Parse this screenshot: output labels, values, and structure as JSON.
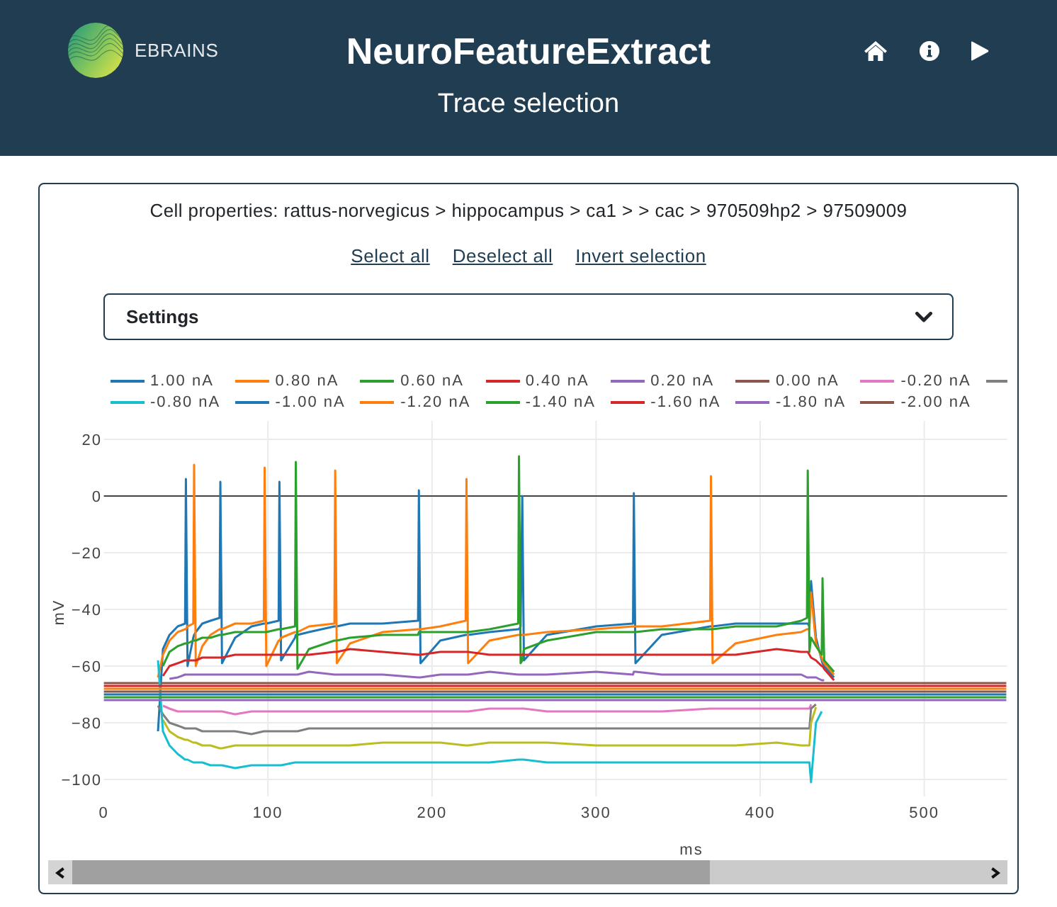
{
  "header": {
    "logo_text": "EBRAINS",
    "title": "NeuroFeatureExtract",
    "subtitle": "Trace selection"
  },
  "cell_properties": "Cell properties: rattus-norvegicus > hippocampus > ca1 > > cac > 970509hp2 > 97509009",
  "selection_links": [
    "Select all",
    "Deselect all",
    "Invert selection"
  ],
  "settings": {
    "label": "Settings",
    "expanded": false
  },
  "chart": {
    "chart_data": {
      "type": "line",
      "xlabel": "ms",
      "ylabel": "mV",
      "grid": true,
      "legend": true,
      "xlim": [
        0,
        550.5
      ],
      "ylim": [
        -106,
        26.5
      ],
      "xticks": [
        0,
        100,
        200,
        300,
        400,
        500
      ],
      "yticks": [
        20,
        0,
        {
          "value": -20,
          "label": "−20"
        },
        {
          "value": -40,
          "label": "−40"
        },
        {
          "value": -60,
          "label": "−60"
        },
        {
          "value": -80,
          "label": "−80"
        },
        {
          "value": -100,
          "label": "−100"
        }
      ],
      "x": [
        0,
        31.5,
        33,
        36,
        40,
        45,
        49.5,
        50,
        51,
        54.5,
        55,
        56,
        60,
        65,
        70.5,
        71,
        72,
        80,
        90,
        97.5,
        98,
        99,
        106.5,
        107,
        108,
        116.5,
        117,
        118,
        125,
        140.5,
        141,
        142,
        150,
        170,
        191.5,
        192,
        193,
        205,
        220.5,
        221,
        222,
        235,
        252.5,
        253,
        254,
        255,
        256,
        270,
        300,
        322.5,
        323,
        324,
        340,
        369.5,
        370,
        371,
        385,
        410,
        425,
        428.5,
        429,
        430,
        431,
        434,
        437.5,
        438,
        439,
        445,
        455,
        470,
        550
      ],
      "series": [
        {
          "name": "1.00 nA",
          "color": "#1f77b4",
          "values": [
            null,
            null,
            -83,
            -54,
            -49,
            -46,
            -45,
            6,
            -60,
            -50,
            -49,
            -48,
            -45,
            -44,
            -43,
            5,
            -59,
            -50,
            -46,
            -45,
            -45,
            -45,
            -44,
            5,
            -58,
            -50,
            -49,
            -49,
            -48,
            -46,
            -46,
            -46,
            -45,
            -45,
            -44,
            2,
            -59,
            -51,
            -49,
            -49,
            -49,
            -48,
            -47,
            -47,
            -46,
            0,
            -58,
            -49,
            -46,
            -45,
            1,
            -59,
            -49,
            -46,
            -46,
            -46,
            -45,
            -45,
            -45,
            -45,
            -45,
            -46,
            -30,
            -50,
            -58,
            -59,
            -60,
            -64,
            null,
            null,
            null
          ]
        },
        {
          "name": "0.80 nA",
          "color": "#ff7f0e",
          "values": [
            null,
            null,
            -64,
            -56,
            -51,
            -48,
            -47,
            -47,
            -46,
            -45,
            11,
            -60,
            -53,
            -49,
            -47,
            -47,
            -47,
            -45,
            -45,
            -44,
            10,
            -60,
            -51,
            -51,
            -50,
            -48,
            -48,
            -48,
            -46,
            -45,
            9,
            -59,
            -52,
            -48,
            -47,
            -47,
            -47,
            -46,
            -44,
            6,
            -59,
            -51,
            -49,
            -49,
            -49,
            -49,
            -49,
            -48,
            -47,
            -46,
            -46,
            -46,
            -46,
            -44,
            7,
            -59,
            -52,
            -49,
            -48,
            -47,
            -47,
            -47,
            -34,
            -52,
            -57,
            -58,
            -59,
            -63,
            null,
            null,
            null
          ]
        },
        {
          "name": "0.60 nA",
          "color": "#2ca02c",
          "values": [
            null,
            null,
            null,
            -60,
            -55,
            -53,
            -52,
            -52,
            -52,
            -51,
            -51,
            -51,
            -50,
            -50,
            -49,
            -49,
            -49,
            -48,
            -48,
            -48,
            -48,
            -48,
            -47,
            -47,
            -47,
            -46,
            12,
            -61,
            -54,
            -51,
            -51,
            -51,
            -50,
            -49,
            -49,
            -48,
            -48,
            -48,
            -48,
            -48,
            -48,
            -47,
            -45,
            14,
            -59,
            -58,
            -54,
            -51,
            -48,
            -48,
            -48,
            -48,
            -47,
            -47,
            -47,
            -47,
            -46,
            -46,
            -44,
            -43,
            9,
            -55,
            -50,
            -53,
            -56,
            -29,
            -58,
            -62,
            null,
            null,
            null
          ]
        },
        {
          "name": "0.40 nA",
          "color": "#d62728",
          "values": [
            null,
            null,
            null,
            -63.5,
            -60,
            -59,
            -58,
            -58,
            -58,
            -58,
            -58,
            -58,
            -57,
            -57,
            -57,
            -57,
            -57,
            -56,
            -56,
            -56,
            -56,
            -56,
            -56,
            -56,
            -56,
            -56,
            -56,
            -56,
            -56,
            -55,
            -55,
            -55,
            -54,
            -55,
            -56,
            -56,
            -56,
            -55,
            -55,
            -55,
            -55,
            -56,
            -56,
            -56,
            -56,
            -56,
            -56,
            -56,
            -56,
            -56,
            -56,
            -56,
            -56,
            -56,
            -56,
            -56,
            -56,
            -54,
            -55,
            -55,
            -55,
            -56,
            -57,
            -58,
            -60,
            -60,
            -61,
            -65,
            null,
            null,
            null
          ]
        },
        {
          "name": "0.20 nA",
          "color": "#9467bd",
          "values": [
            null,
            null,
            null,
            null,
            -64.5,
            -64,
            -63,
            -63,
            -63,
            -63,
            -63,
            -63,
            -63,
            -63,
            -63,
            -63,
            -63,
            -63,
            -63,
            -63,
            -63,
            -63,
            -63,
            -63,
            -63,
            -63,
            -63,
            -63,
            -62,
            -63,
            -63,
            -63,
            -63,
            -63,
            -64,
            -64,
            -64,
            -63,
            -63,
            -63,
            -63,
            -62,
            -63,
            -63,
            -63,
            -63,
            -63,
            -63,
            -62,
            -63,
            -62,
            -62,
            -63,
            -63,
            -63,
            -63,
            -63,
            -63,
            -63,
            -64,
            -64,
            -64,
            -64,
            -64,
            -65,
            -65,
            -65,
            null,
            null,
            null,
            null
          ]
        },
        {
          "name": "0.00 nA",
          "color": "#8c564b",
          "values": [
            -66,
            -66,
            -66,
            -66,
            -66,
            -66,
            -66,
            -66,
            -66,
            -66,
            -66,
            -66,
            -66,
            -66,
            -66,
            -66,
            -66,
            -66,
            -66,
            -66,
            -66,
            -66,
            -66,
            -66,
            -66,
            -66,
            -66,
            -66,
            -66,
            -66,
            -66,
            -66,
            -66,
            -66,
            -66,
            -66,
            -66,
            -66,
            -66,
            -66,
            -66,
            -66,
            -66,
            -66,
            -66,
            -66,
            -66,
            -66,
            -66,
            -66,
            -66,
            -66,
            -66,
            -66,
            -66,
            -66,
            -66,
            -66,
            -66,
            -66,
            -66,
            -66,
            -66,
            -66,
            -66,
            -66,
            -66,
            -66,
            -66,
            -66,
            -66
          ]
        },
        {
          "name": "-0.20 nA",
          "color": "#e377c2",
          "values": [
            null,
            null,
            null,
            -74,
            -75,
            -76,
            -76,
            -76,
            -76,
            -76,
            -76,
            -76,
            -76,
            -76,
            -76,
            -76,
            -76,
            -77,
            -76,
            -76,
            -76,
            -76,
            -76,
            -76,
            -76,
            -76,
            -76,
            -76,
            -76,
            -76,
            -76,
            -76,
            -76,
            -76,
            -76,
            -76,
            -76,
            -76,
            -76,
            -76,
            -76,
            -75,
            -75,
            -75,
            -75,
            -75,
            -75,
            -76,
            -76,
            -76,
            -76,
            -76,
            -76,
            -75,
            -75,
            -75,
            -75,
            -75,
            -75,
            -75,
            -75,
            -75,
            -73.5,
            null,
            null,
            null,
            null,
            null,
            null,
            null,
            null
          ]
        },
        {
          "color": "#7f7f7f",
          "values": [
            null,
            null,
            -74,
            -77,
            -80,
            -81,
            -82,
            -82,
            -82,
            -82,
            -82,
            -82,
            -83,
            -83,
            -83,
            -83,
            -83,
            -83,
            -84,
            -83,
            -83,
            -83,
            -83,
            -83,
            -83,
            -83,
            -83,
            -83,
            -82,
            -82,
            -82,
            -82,
            -82,
            -82,
            -82,
            -82,
            -82,
            -82,
            -82,
            -82,
            -82,
            -82,
            -82,
            -82,
            -82,
            -82,
            -82,
            -82,
            -82,
            -82,
            -82,
            -82,
            -82,
            -82,
            -82,
            -82,
            -82,
            -82,
            -82,
            -82,
            -82,
            -82,
            -75,
            -73.5,
            null,
            null,
            null,
            null,
            null,
            null,
            null
          ]
        },
        {
          "color": "#bcbd22",
          "values": [
            null,
            null,
            null,
            -79,
            -83,
            -85,
            -86,
            -86,
            -86,
            -87,
            -87,
            -87,
            -88,
            -88,
            -89,
            -89,
            -89,
            -88,
            -88,
            -88,
            -88,
            -88,
            -88,
            -88,
            -88,
            -88,
            -88,
            -88,
            -88,
            -88,
            -88,
            -88,
            -88,
            -87,
            -87,
            -87,
            -87,
            -87,
            -88,
            -88,
            -88,
            -87,
            -87,
            -87,
            -87,
            -87,
            -87,
            -87,
            -88,
            -88,
            -88,
            -88,
            -88,
            -88,
            -88,
            -88,
            -88,
            -87,
            -88,
            -88,
            -88,
            -88,
            -80,
            -74.5,
            null,
            null,
            null,
            null,
            null,
            null,
            null
          ]
        },
        {
          "name": "-0.80 nA",
          "color": "#17becf",
          "values": [
            null,
            null,
            -58,
            -83,
            -88,
            -91,
            -93,
            -93,
            -93,
            -94,
            -94,
            -94,
            -94,
            -95,
            -95,
            -95,
            -95,
            -96,
            -95,
            -95,
            -95,
            -95,
            -95,
            -95,
            -95,
            -94,
            -94,
            -94,
            -94,
            -94,
            -94,
            -94,
            -94,
            -94,
            -94,
            -94,
            -94,
            -94,
            -94,
            -94,
            -94,
            -94,
            -93,
            -93,
            -93,
            -93,
            -93,
            -94,
            -94,
            -94,
            -94,
            -94,
            -94,
            -94,
            -94,
            -94,
            -94,
            -94,
            -94,
            -94,
            -94,
            -94,
            -101,
            -80,
            -76,
            null,
            null,
            null,
            null,
            null,
            null
          ]
        },
        {
          "name": "-1.00 nA",
          "color": "#1f77b4",
          "values": [
            -70,
            -70,
            -70,
            -70,
            -70,
            -70,
            -70,
            -70,
            -70,
            -70,
            -70,
            -70,
            -70,
            -70,
            -70,
            -70,
            -70,
            -70,
            -70,
            -70,
            -70,
            -70,
            -70,
            -70,
            -70,
            -70,
            -70,
            -70,
            -70,
            -70,
            -70,
            -70,
            -70,
            -70,
            -70,
            -70,
            -70,
            -70,
            -70,
            -70,
            -70,
            -70,
            -70,
            -70,
            -70,
            -70,
            -70,
            -70,
            -70,
            -70,
            -70,
            -70,
            -70,
            -70,
            -70,
            -70,
            -70,
            -70,
            -70,
            -70,
            -70,
            -70,
            -70,
            -70,
            -70,
            -70,
            -70,
            -70,
            -70,
            -70,
            -70
          ]
        },
        {
          "name": "-1.20 nA",
          "color": "#ff7f0e",
          "values": [
            -68,
            -68,
            -68,
            -68,
            -68,
            -68,
            -68,
            -68,
            -68,
            -68,
            -68,
            -68,
            -68,
            -68,
            -68,
            -68,
            -68,
            -68,
            -68,
            -68,
            -68,
            -68,
            -68,
            -68,
            -68,
            -68,
            -68,
            -68,
            -68,
            -68,
            -68,
            -68,
            -68,
            -68,
            -68,
            -68,
            -68,
            -68,
            -68,
            -68,
            -68,
            -68,
            -68,
            -68,
            -68,
            -68,
            -68,
            -68,
            -68,
            -68,
            -68,
            -68,
            -68,
            -68,
            -68,
            -68,
            -68,
            -68,
            -68,
            -68,
            -68,
            -68,
            -68,
            -68,
            -68,
            -68,
            -68,
            -68,
            -68,
            -68,
            -68
          ]
        },
        {
          "name": "-1.40 nA",
          "color": "#2ca02c",
          "values": [
            -71,
            -71,
            -71,
            -71,
            -71,
            -71,
            -71,
            -71,
            -71,
            -71,
            -71,
            -71,
            -71,
            -71,
            -71,
            -71,
            -71,
            -71,
            -71,
            -71,
            -71,
            -71,
            -71,
            -71,
            -71,
            -71,
            -71,
            -71,
            -71,
            -71,
            -71,
            -71,
            -71,
            -71,
            -71,
            -71,
            -71,
            -71,
            -71,
            -71,
            -71,
            -71,
            -71,
            -71,
            -71,
            -71,
            -71,
            -71,
            -71,
            -71,
            -71,
            -71,
            -71,
            -71,
            -71,
            -71,
            -71,
            -71,
            -71,
            -71,
            -71,
            -71,
            -71,
            -71,
            -71,
            -71,
            -71,
            -71,
            -71,
            -71,
            -71
          ]
        },
        {
          "name": "-1.60 nA",
          "color": "#d62728",
          "values": [
            -67,
            -67,
            -67,
            -67,
            -67,
            -67,
            -67,
            -67,
            -67,
            -67,
            -67,
            -67,
            -67,
            -67,
            -67,
            -67,
            -67,
            -67,
            -67,
            -67,
            -67,
            -67,
            -67,
            -67,
            -67,
            -67,
            -67,
            -67,
            -67,
            -67,
            -67,
            -67,
            -67,
            -67,
            -67,
            -67,
            -67,
            -67,
            -67,
            -67,
            -67,
            -67,
            -67,
            -67,
            -67,
            -67,
            -67,
            -67,
            -67,
            -67,
            -67,
            -67,
            -67,
            -67,
            -67,
            -67,
            -67,
            -67,
            -67,
            -67,
            -67,
            -67,
            -67,
            -67,
            -67,
            -67,
            -67,
            -67,
            -67,
            -67,
            -67
          ]
        },
        {
          "name": "-1.80 nA",
          "color": "#9467bd",
          "values": [
            -72,
            -72,
            -72,
            -72,
            -72,
            -72,
            -72,
            -72,
            -72,
            -72,
            -72,
            -72,
            -72,
            -72,
            -72,
            -72,
            -72,
            -72,
            -72,
            -72,
            -72,
            -72,
            -72,
            -72,
            -72,
            -72,
            -72,
            -72,
            -72,
            -72,
            -72,
            -72,
            -72,
            -72,
            -72,
            -72,
            -72,
            -72,
            -72,
            -72,
            -72,
            -72,
            -72,
            -72,
            -72,
            -72,
            -72,
            -72,
            -72,
            -72,
            -72,
            -72,
            -72,
            -72,
            -72,
            -72,
            -72,
            -72,
            -72,
            -72,
            -72,
            -72,
            -72,
            -72,
            -72,
            -72,
            -72,
            -72,
            -72,
            -72,
            -72
          ]
        },
        {
          "name": "-2.00 nA",
          "color": "#8c564b",
          "values": [
            -69,
            -69,
            -69,
            -69,
            -69,
            -69,
            -69,
            -69,
            -69,
            -69,
            -69,
            -69,
            -69,
            -69,
            -69,
            -69,
            -69,
            -69,
            -69,
            -69,
            -69,
            -69,
            -69,
            -69,
            -69,
            -69,
            -69,
            -69,
            -69,
            -69,
            -69,
            -69,
            -69,
            -69,
            -69,
            -69,
            -69,
            -69,
            -69,
            -69,
            -69,
            -69,
            -69,
            -69,
            -69,
            -69,
            -69,
            -69,
            -69,
            -69,
            -69,
            -69,
            -69,
            -69,
            -69,
            -69,
            -69,
            -69,
            -69,
            -69,
            -69,
            -69,
            -69,
            -69,
            -69,
            -69,
            -69,
            -69,
            -69,
            -69,
            -69
          ]
        }
      ]
    }
  }
}
